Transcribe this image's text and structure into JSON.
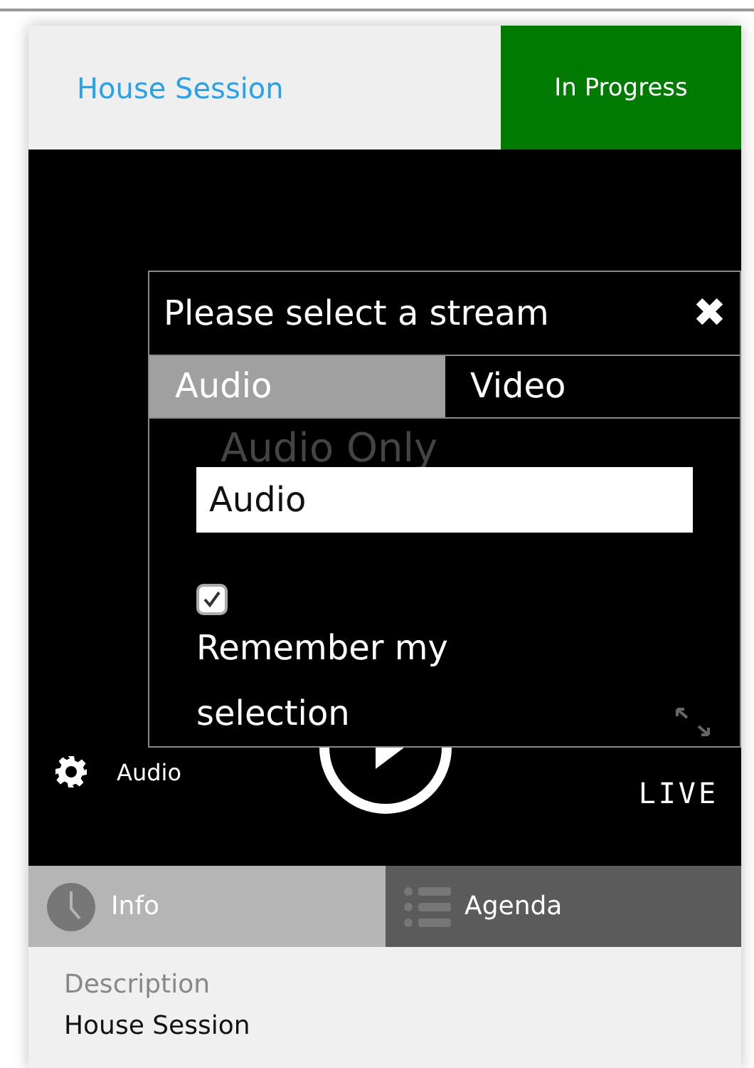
{
  "header": {
    "title": "House Session",
    "status": "In Progress"
  },
  "player": {
    "settings_label": "Audio",
    "live_label": "LIVE"
  },
  "dialog": {
    "title": "Please select a stream",
    "close": "✖",
    "tabs": [
      {
        "label": "Audio",
        "selected": true
      },
      {
        "label": "Video",
        "selected": false
      }
    ],
    "stream_label": "Audio Only",
    "stream_value": "Audio",
    "remember": {
      "label": "Remember my selection",
      "checked": true
    }
  },
  "tabs": [
    {
      "label": "Info",
      "kind": "clock",
      "selected": true
    },
    {
      "label": "Agenda",
      "kind": "list",
      "selected": false
    }
  ],
  "info": {
    "label": "Description",
    "value": "House Session"
  }
}
